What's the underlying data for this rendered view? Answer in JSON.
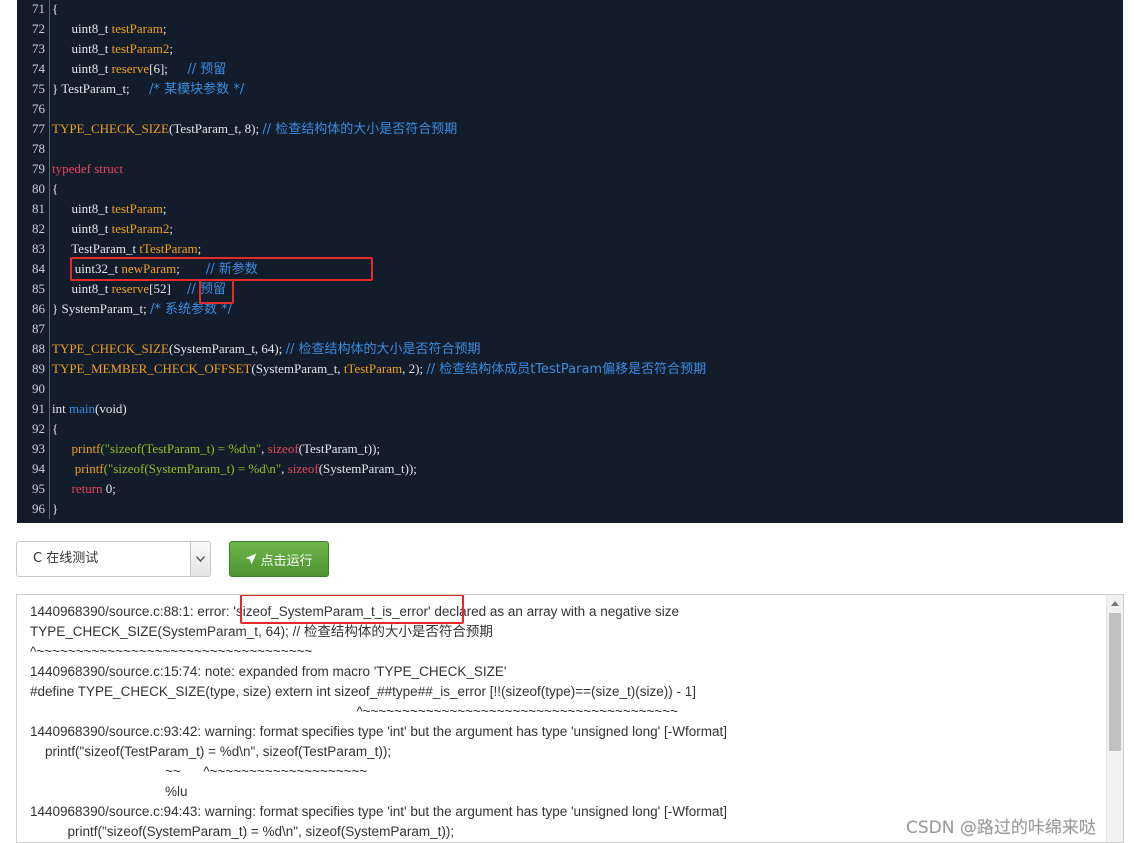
{
  "editor": {
    "lines": [
      {
        "n": "71",
        "tokens": [
          {
            "t": "{",
            "c": ""
          }
        ]
      },
      {
        "n": "72",
        "tokens": [
          {
            "t": "      uint8_t ",
            "c": ""
          },
          {
            "t": "testParam",
            "c": "var"
          },
          {
            "t": ";",
            "c": ""
          }
        ]
      },
      {
        "n": "73",
        "tokens": [
          {
            "t": "      uint8_t ",
            "c": ""
          },
          {
            "t": "testParam2",
            "c": "var"
          },
          {
            "t": ";",
            "c": ""
          }
        ]
      },
      {
        "n": "74",
        "tokens": [
          {
            "t": "      uint8_t ",
            "c": ""
          },
          {
            "t": "reserve",
            "c": "var"
          },
          {
            "t": "[6];      ",
            "c": ""
          },
          {
            "t": "// 预留",
            "c": "cm"
          }
        ]
      },
      {
        "n": "75",
        "tokens": [
          {
            "t": "} TestParam_t;      ",
            "c": ""
          },
          {
            "t": "/* 某模块参数 */",
            "c": "cm"
          }
        ]
      },
      {
        "n": "76",
        "tokens": []
      },
      {
        "n": "77",
        "tokens": [
          {
            "t": "TYPE_CHECK_SIZE",
            "c": "mac"
          },
          {
            "t": "(TestParam_t, 8); ",
            "c": ""
          },
          {
            "t": "// 检查结构体的大小是否符合预期",
            "c": "cm"
          }
        ]
      },
      {
        "n": "78",
        "tokens": []
      },
      {
        "n": "79",
        "tokens": [
          {
            "t": "typedef struct",
            "c": "kw"
          }
        ]
      },
      {
        "n": "80",
        "tokens": [
          {
            "t": "{",
            "c": ""
          }
        ]
      },
      {
        "n": "81",
        "tokens": [
          {
            "t": "      uint8_t ",
            "c": ""
          },
          {
            "t": "testParam",
            "c": "var"
          },
          {
            "t": ";",
            "c": ""
          }
        ]
      },
      {
        "n": "82",
        "tokens": [
          {
            "t": "      uint8_t ",
            "c": ""
          },
          {
            "t": "testParam2",
            "c": "var"
          },
          {
            "t": ";",
            "c": ""
          }
        ]
      },
      {
        "n": "83",
        "tokens": [
          {
            "t": "      TestParam_t ",
            "c": ""
          },
          {
            "t": "tTestParam",
            "c": "var"
          },
          {
            "t": ";",
            "c": ""
          }
        ]
      },
      {
        "n": "84",
        "tokens": [
          {
            "t": "       uint32_t ",
            "c": ""
          },
          {
            "t": "newParam",
            "c": "var"
          },
          {
            "t": ";        ",
            "c": ""
          },
          {
            "t": "// 新参数",
            "c": "cm"
          }
        ]
      },
      {
        "n": "85",
        "tokens": [
          {
            "t": "      uint8_t ",
            "c": ""
          },
          {
            "t": "reserve",
            "c": "var"
          },
          {
            "t": "[52]     ",
            "c": ""
          },
          {
            "t": "// 预留",
            "c": "cm"
          }
        ]
      },
      {
        "n": "86",
        "tokens": [
          {
            "t": "} SystemParam_t; ",
            "c": ""
          },
          {
            "t": "/* 系统参数 */",
            "c": "cm"
          }
        ]
      },
      {
        "n": "87",
        "tokens": []
      },
      {
        "n": "88",
        "tokens": [
          {
            "t": "TYPE_CHECK_SIZE",
            "c": "mac"
          },
          {
            "t": "(SystemParam_t, 64); ",
            "c": ""
          },
          {
            "t": "// 检查结构体的大小是否符合预期",
            "c": "cm"
          }
        ]
      },
      {
        "n": "89",
        "tokens": [
          {
            "t": "TYPE_MEMBER_CHECK_OFFSET",
            "c": "mac"
          },
          {
            "t": "(SystemParam_t, ",
            "c": ""
          },
          {
            "t": "tTestParam",
            "c": "var"
          },
          {
            "t": ", 2); ",
            "c": ""
          },
          {
            "t": "// 检查结构体成员tTestParam偏移是否符合预期",
            "c": "cm"
          }
        ]
      },
      {
        "n": "90",
        "tokens": []
      },
      {
        "n": "91",
        "tokens": [
          {
            "t": "int ",
            "c": ""
          },
          {
            "t": "main",
            "c": "fn"
          },
          {
            "t": "(void)",
            "c": ""
          }
        ]
      },
      {
        "n": "92",
        "tokens": [
          {
            "t": "{",
            "c": ""
          }
        ]
      },
      {
        "n": "93",
        "tokens": [
          {
            "t": "      ",
            "c": ""
          },
          {
            "t": "printf",
            "c": "var"
          },
          {
            "t": "(\"sizeof(TestParam_t) = %d\\n\"",
            "c": "str"
          },
          {
            "t": ", ",
            "c": ""
          },
          {
            "t": "sizeof",
            "c": "kw"
          },
          {
            "t": "(TestParam_t));",
            "c": ""
          }
        ]
      },
      {
        "n": "94",
        "tokens": [
          {
            "t": "       ",
            "c": ""
          },
          {
            "t": "printf",
            "c": "var"
          },
          {
            "t": "(\"sizeof(SystemParam_t) = %d\\n\"",
            "c": "str"
          },
          {
            "t": ", ",
            "c": ""
          },
          {
            "t": "sizeof",
            "c": "kw"
          },
          {
            "t": "(SystemParam_t));",
            "c": ""
          }
        ]
      },
      {
        "n": "95",
        "tokens": [
          {
            "t": "      ",
            "c": ""
          },
          {
            "t": "return",
            "c": "kw"
          },
          {
            "t": " 0;",
            "c": ""
          }
        ]
      },
      {
        "n": "96",
        "tokens": [
          {
            "t": "}",
            "c": ""
          }
        ]
      }
    ]
  },
  "toolbar": {
    "language": "C 在线测试",
    "run_label": "点击运行"
  },
  "output": {
    "lines": [
      "1440968390/source.c:88:1: error: 'sizeof_SystemParam_t_is_error' declared as an array with a negative size",
      "TYPE_CHECK_SIZE(SystemParam_t, 64); // 检查结构体的大小是否符合预期",
      "^~~~~~~~~~~~~~~~~~~~~~~~~~~~~~~~~~~~",
      "1440968390/source.c:15:74: note: expanded from macro 'TYPE_CHECK_SIZE'",
      "#define TYPE_CHECK_SIZE(type, size) extern int sizeof_##type##_is_error [!!(sizeof(type)==(size_t)(size)) - 1]",
      "                                                                                       ^~~~~~~~~~~~~~~~~~~~~~~~~~~~~~~~~~~~~~~~~",
      "1440968390/source.c:93:42: warning: format specifies type 'int' but the argument has type 'unsigned long' [-Wformat]",
      "    printf(\"sizeof(TestParam_t) = %d\\n\", sizeof(TestParam_t));",
      "                                    ~~      ^~~~~~~~~~~~~~~~~~~~~",
      "                                    %lu",
      "1440968390/source.c:94:43: warning: format specifies type 'int' but the argument has type 'unsigned long' [-Wformat]",
      "          printf(\"sizeof(SystemParam_t) = %d\\n\", sizeof(SystemParam_t));"
    ]
  },
  "watermark": "CSDN @路过的咔绵来哒",
  "colors": {
    "highlight_box": "#e52a2a",
    "run_button": "#5aa33c",
    "editor_bg": "#131c2b"
  }
}
